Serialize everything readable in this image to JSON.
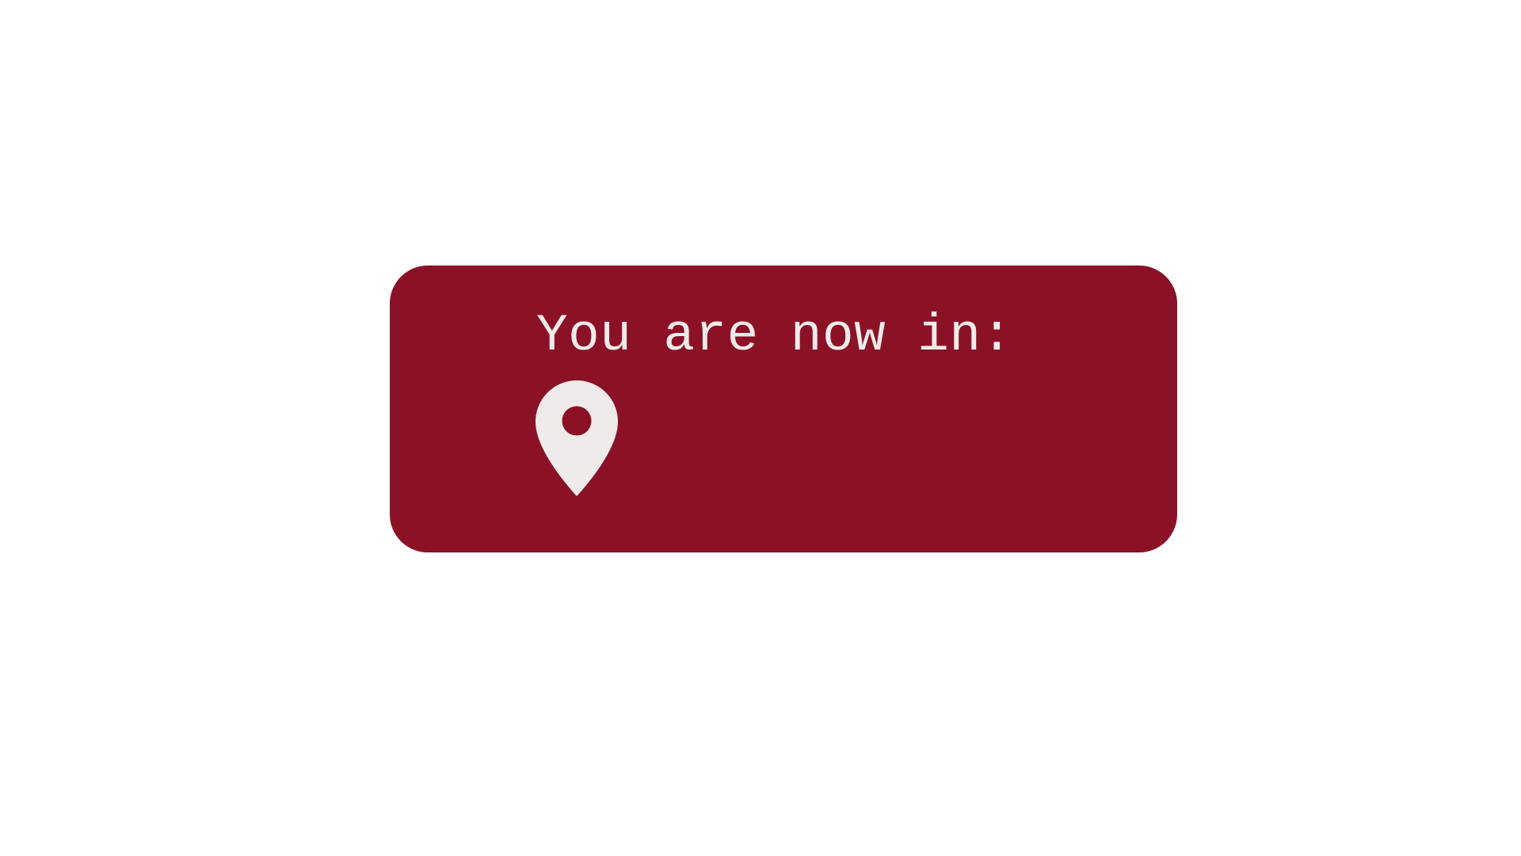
{
  "card": {
    "heading": "You are now in:",
    "icon": "map-pin-icon",
    "colors": {
      "background": "#8b1226",
      "foreground": "#efebea"
    }
  }
}
